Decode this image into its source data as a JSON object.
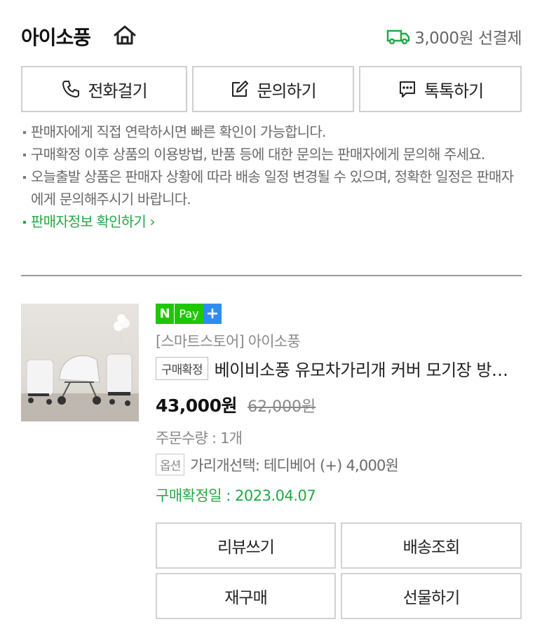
{
  "header": {
    "store_name": "아이소풍",
    "home_icon": "home-icon",
    "shipping_text": "3,000원 선결제",
    "truck_icon": "truck-icon",
    "accent_green": "#22a845"
  },
  "contact": {
    "call_label": "전화걸기",
    "inquiry_label": "문의하기",
    "talk_label": "톡톡하기",
    "icons": [
      "phone-icon",
      "edit-icon",
      "chat-icon"
    ]
  },
  "notes": [
    "판매자에게 직접 연락하시면 빠른 확인이 가능합니다.",
    "구매확정 이후 상품의 이용방법, 반품 등에 대한 문의는 판매자에게 문의해 주세요.",
    "오늘출발 상품은 판매자 상황에 따라 배송 일정 변경될 수 있으며, 정확한 일정은 판매자에게 문의해주시기 바랍니다."
  ],
  "seller_info_link": "판매자정보 확인하기",
  "order": {
    "npay_n": "N",
    "npay_pay": "Pay",
    "npay_plus": "+",
    "store_line": "[스마트스토어] 아이소풍",
    "status_badge": "구매확정",
    "product_title": "베이비소풍 유모차가리개 커버 모기장 방풍 방한 다용도",
    "price": "43,000원",
    "original_price": "62,000원",
    "quantity": "주문수량 : 1개",
    "option_badge": "옵션",
    "option_text": "가리개선택: 테디베어 (+) 4,000원",
    "confirm_date": "구매확정일 : 2023.04.07"
  },
  "actions": {
    "review": "리뷰쓰기",
    "track": "배송조회",
    "rebuy": "재구매",
    "gift": "선물하기"
  }
}
